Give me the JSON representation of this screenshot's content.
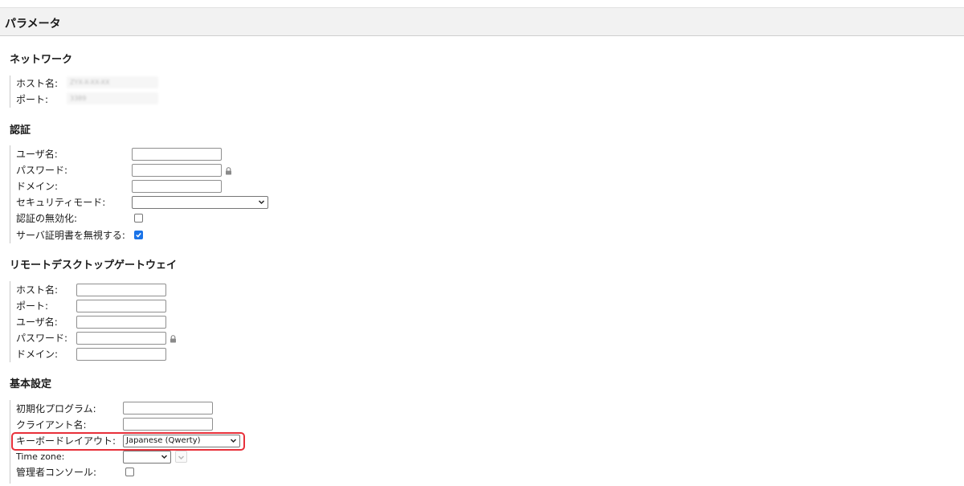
{
  "header": {
    "title": "パラメータ"
  },
  "network": {
    "title": "ネットワーク",
    "hostname_label": "ホスト名:",
    "hostname_value": "ZYX-X-XX-XX",
    "port_label": "ポート:",
    "port_value": "3389"
  },
  "auth": {
    "title": "認証",
    "username_label": "ユーザ名:",
    "username_value": "",
    "password_label": "パスワード:",
    "password_value": "",
    "domain_label": "ドメイン:",
    "domain_value": "",
    "security_mode_label": "セキュリティモード:",
    "security_mode_value": "",
    "disable_auth_label": "認証の無効化:",
    "disable_auth_checked": false,
    "ignore_cert_label": "サーバ証明書を無視する:",
    "ignore_cert_checked": true
  },
  "gateway": {
    "title": "リモートデスクトップゲートウェイ",
    "hostname_label": "ホスト名:",
    "hostname_value": "",
    "port_label": "ポート:",
    "port_value": "",
    "username_label": "ユーザ名:",
    "username_value": "",
    "password_label": "パスワード:",
    "password_value": "",
    "domain_label": "ドメイン:",
    "domain_value": ""
  },
  "basic": {
    "title": "基本設定",
    "init_program_label": "初期化プログラム:",
    "init_program_value": "",
    "client_name_label": "クライアント名:",
    "client_name_value": "",
    "keyboard_layout_label": "キーボードレイアウト:",
    "keyboard_layout_value": "Japanese (Qwerty)",
    "timezone_label": "Time zone:",
    "timezone_value": "",
    "admin_console_label": "管理者コンソール:",
    "admin_console_checked": false
  },
  "colors": {
    "highlight": "#e8303a",
    "checkbox_checked": "#1a73e8"
  }
}
